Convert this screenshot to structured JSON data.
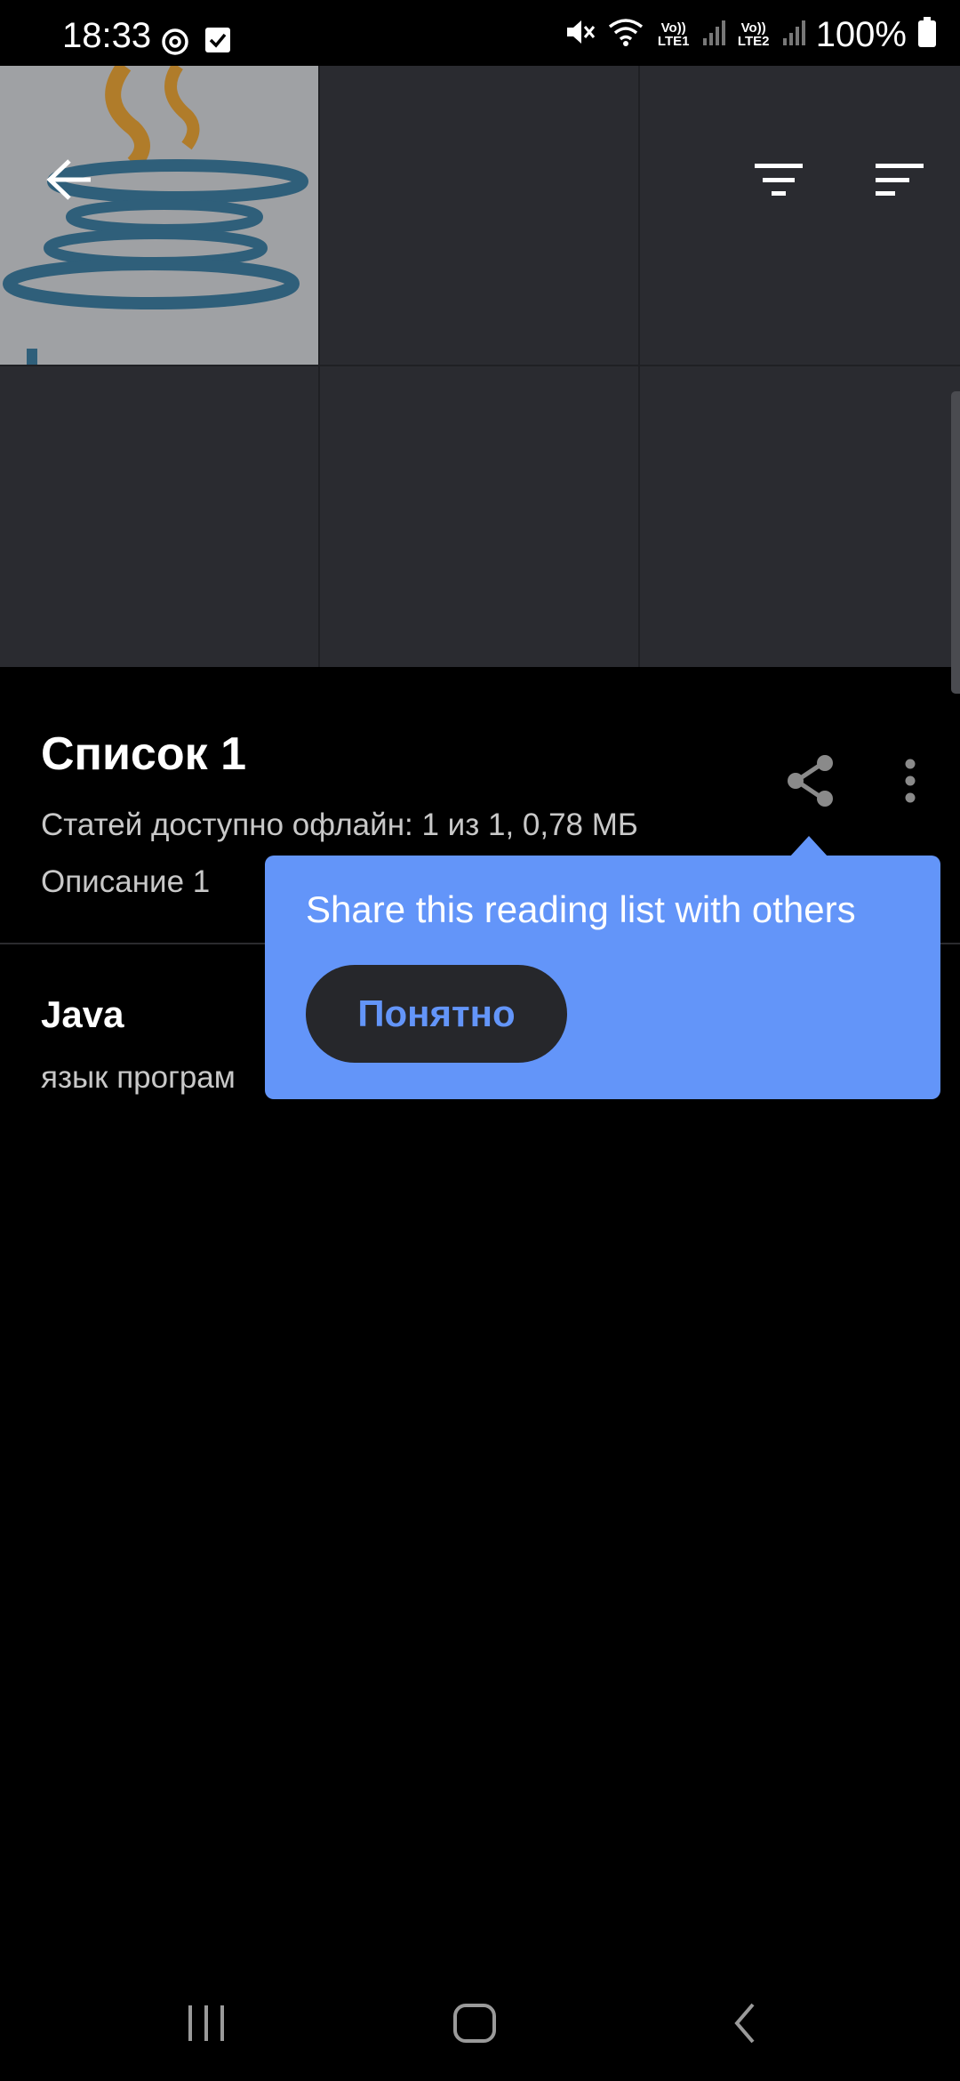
{
  "status_bar": {
    "time": "18:33",
    "lte1": "Vo)) LTE1",
    "lte2": "Vo)) LTE2",
    "battery": "100%",
    "icons": [
      "sync-icon",
      "check-box-icon",
      "mute-icon",
      "wifi-icon",
      "signal-icon",
      "signal-icon",
      "battery-icon"
    ]
  },
  "header": {
    "back_icon": "arrow-back-icon",
    "filter_icon": "filter-icon",
    "sort_icon": "sort-icon"
  },
  "list": {
    "title": "Список 1",
    "stats": "Статей доступно офлайн: 1 из 1, 0,78 МБ",
    "description": "Описание 1",
    "share_icon": "share-icon",
    "more_icon": "more-vert-icon"
  },
  "articles": [
    {
      "title": "Java",
      "description": "язык програм"
    }
  ],
  "tooltip": {
    "text": "Share this reading list with others",
    "button": "Понятно",
    "color": "#6395f9"
  },
  "nav_bar": {
    "icons": [
      "recents-icon",
      "home-icon",
      "back-icon"
    ]
  }
}
